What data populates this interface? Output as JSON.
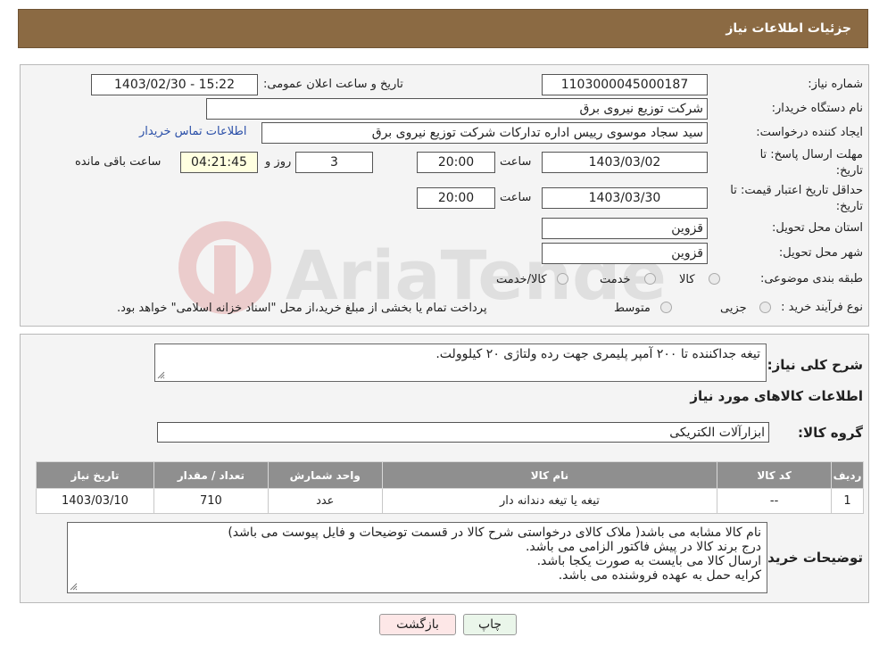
{
  "header": {
    "title": "جزئیات اطلاعات نیاز"
  },
  "form": {
    "need_number_label": "شماره نیاز:",
    "need_number": "1103000045000187",
    "announce_label": "تاریخ و ساعت اعلان عمومی:",
    "announce_value": "1403/02/30 - 15:22",
    "buyer_org_label": "نام دستگاه خریدار:",
    "buyer_org": "شرکت توزیع نیروی برق",
    "creator_label": "ایجاد کننده درخواست:",
    "creator": "سید سجاد موسوی رییس اداره تدارکات شرکت توزیع نیروی برق",
    "contact_link": "اطلاعات تماس خریدار",
    "deadline_label_1": "مهلت ارسال پاسخ: تا",
    "deadline_label_2": "تاریخ:",
    "deadline_date": "1403/03/02",
    "time_label": "ساعت",
    "deadline_time": "20:00",
    "days": "3",
    "days_label": "روز و",
    "remaining_time": "04:21:45",
    "remaining_label": "ساعت باقی مانده",
    "validity_label_1": "حداقل تاریخ اعتبار قیمت: تا",
    "validity_label_2": "تاریخ:",
    "validity_date": "1403/03/30",
    "validity_time": "20:00",
    "province_label": "استان محل تحویل:",
    "province": "قزوین",
    "city_label": "شهر محل تحویل:",
    "city": "قزوین",
    "category_label": "طبقه بندی موضوعی:",
    "category_options": [
      "کالا",
      "خدمت",
      "کالا/خدمت"
    ],
    "process_label": "نوع فرآیند خرید :",
    "process_options": [
      "جزیی",
      "متوسط"
    ],
    "payment_note": "پرداخت تمام یا بخشی از مبلغ خرید،از محل \"اسناد خزانه اسلامی\" خواهد بود."
  },
  "details": {
    "summary_label": "شرح کلی نیاز:",
    "summary": "تیغه جداکننده تا ۲۰۰ آمپر پلیمری جهت رده ولتاژی ۲۰ کیلوولت.",
    "goods_info_title": "اطلاعات کالاهای مورد نیاز",
    "group_label": "گروه کالا:",
    "group": "ابزارآلات الکتریکی",
    "table": {
      "headers": [
        "ردیف",
        "کد کالا",
        "نام کالا",
        "واحد شمارش",
        "تعداد / مقدار",
        "تاریخ نیاز"
      ],
      "rows": [
        [
          "1",
          "--",
          "تیغه یا تیغه دندانه دار",
          "عدد",
          "710",
          "1403/03/10"
        ]
      ]
    },
    "notes_label": "توضیحات خریدار:",
    "notes": [
      "نام کالا مشابه می باشد( ملاک کالای درخواستی شرح کالا در قسمت توضیحات و فایل پیوست می باشد)",
      "درج برند کالا در پیش فاکتور الزامی می باشد.",
      "ارسال کالا می بایست به صورت یکجا باشد.",
      "کرایه حمل به عهده فروشنده می باشد."
    ]
  },
  "buttons": {
    "print": "چاپ",
    "back": "بازگشت"
  },
  "watermark": {
    "text": "AriaTender.neT"
  }
}
